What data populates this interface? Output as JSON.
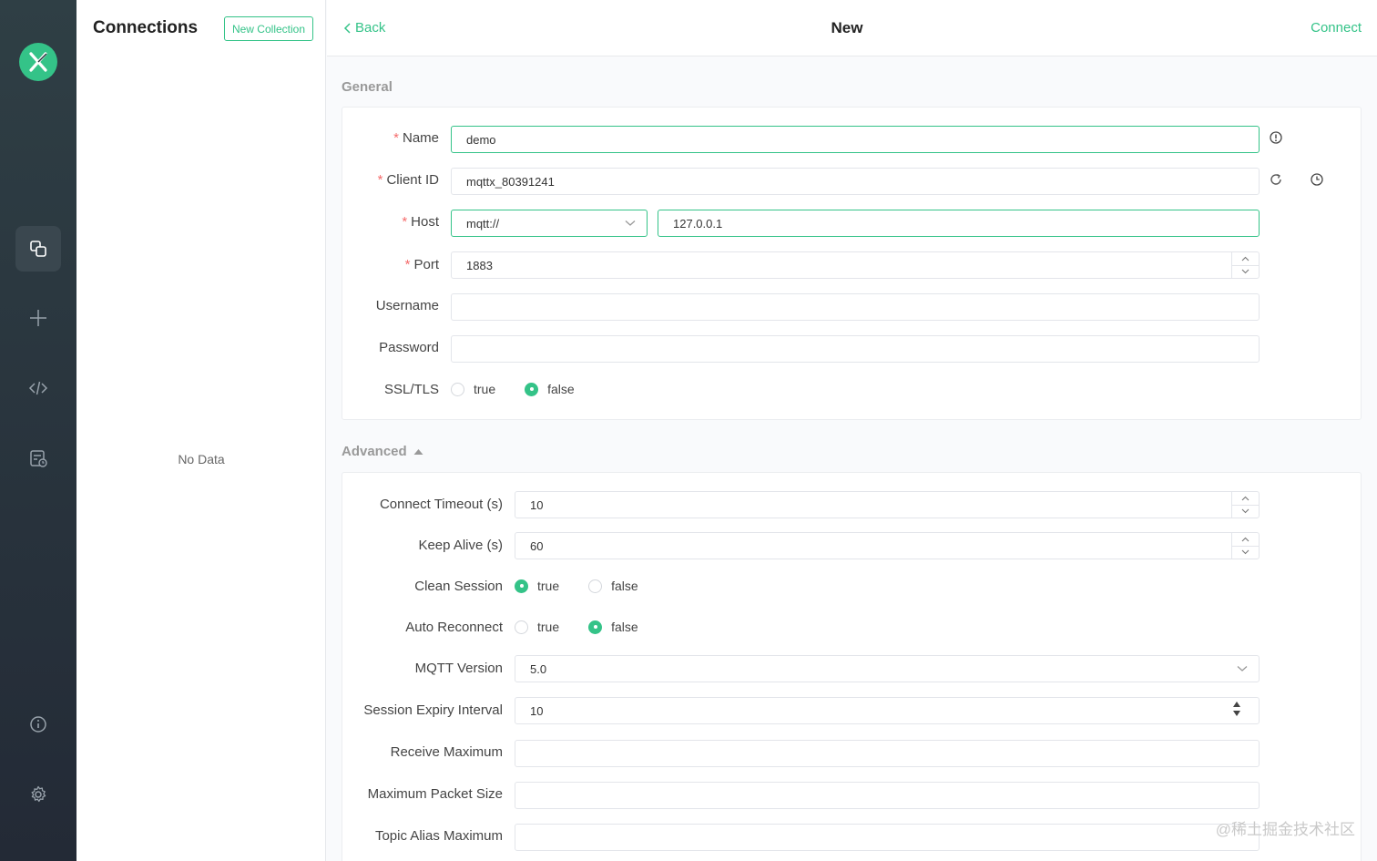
{
  "connections": {
    "title": "Connections",
    "new_collection_label": "New Collection",
    "empty_text": "No Data"
  },
  "header": {
    "back_label": "Back",
    "title": "New",
    "connect_label": "Connect"
  },
  "general": {
    "section_title": "General",
    "name": {
      "label": "Name",
      "value": "demo"
    },
    "client_id": {
      "label": "Client ID",
      "value": "mqttx_80391241"
    },
    "host": {
      "label": "Host",
      "protocol": "mqtt://",
      "value": "127.0.0.1"
    },
    "port": {
      "label": "Port",
      "value": "1883"
    },
    "username": {
      "label": "Username",
      "value": ""
    },
    "password": {
      "label": "Password",
      "value": ""
    },
    "ssl_tls": {
      "label": "SSL/TLS",
      "options": [
        "true",
        "false"
      ],
      "selected": "false"
    }
  },
  "advanced": {
    "section_title": "Advanced",
    "connect_timeout": {
      "label": "Connect Timeout (s)",
      "value": "10"
    },
    "keep_alive": {
      "label": "Keep Alive (s)",
      "value": "60"
    },
    "clean_session": {
      "label": "Clean Session",
      "options": [
        "true",
        "false"
      ],
      "selected": "true"
    },
    "auto_reconnect": {
      "label": "Auto Reconnect",
      "options": [
        "true",
        "false"
      ],
      "selected": "false"
    },
    "mqtt_version": {
      "label": "MQTT Version",
      "value": "5.0"
    },
    "session_expiry": {
      "label": "Session Expiry Interval",
      "value": "10"
    },
    "receive_maximum": {
      "label": "Receive Maximum",
      "value": ""
    },
    "max_packet_size": {
      "label": "Maximum Packet Size",
      "value": ""
    },
    "topic_alias_max": {
      "label": "Topic Alias Maximum",
      "value": ""
    }
  },
  "watermark": "@稀土掘金技术社区",
  "colors": {
    "accent": "#34c388",
    "required": "#f56c6c",
    "rail": "#2a3540"
  }
}
